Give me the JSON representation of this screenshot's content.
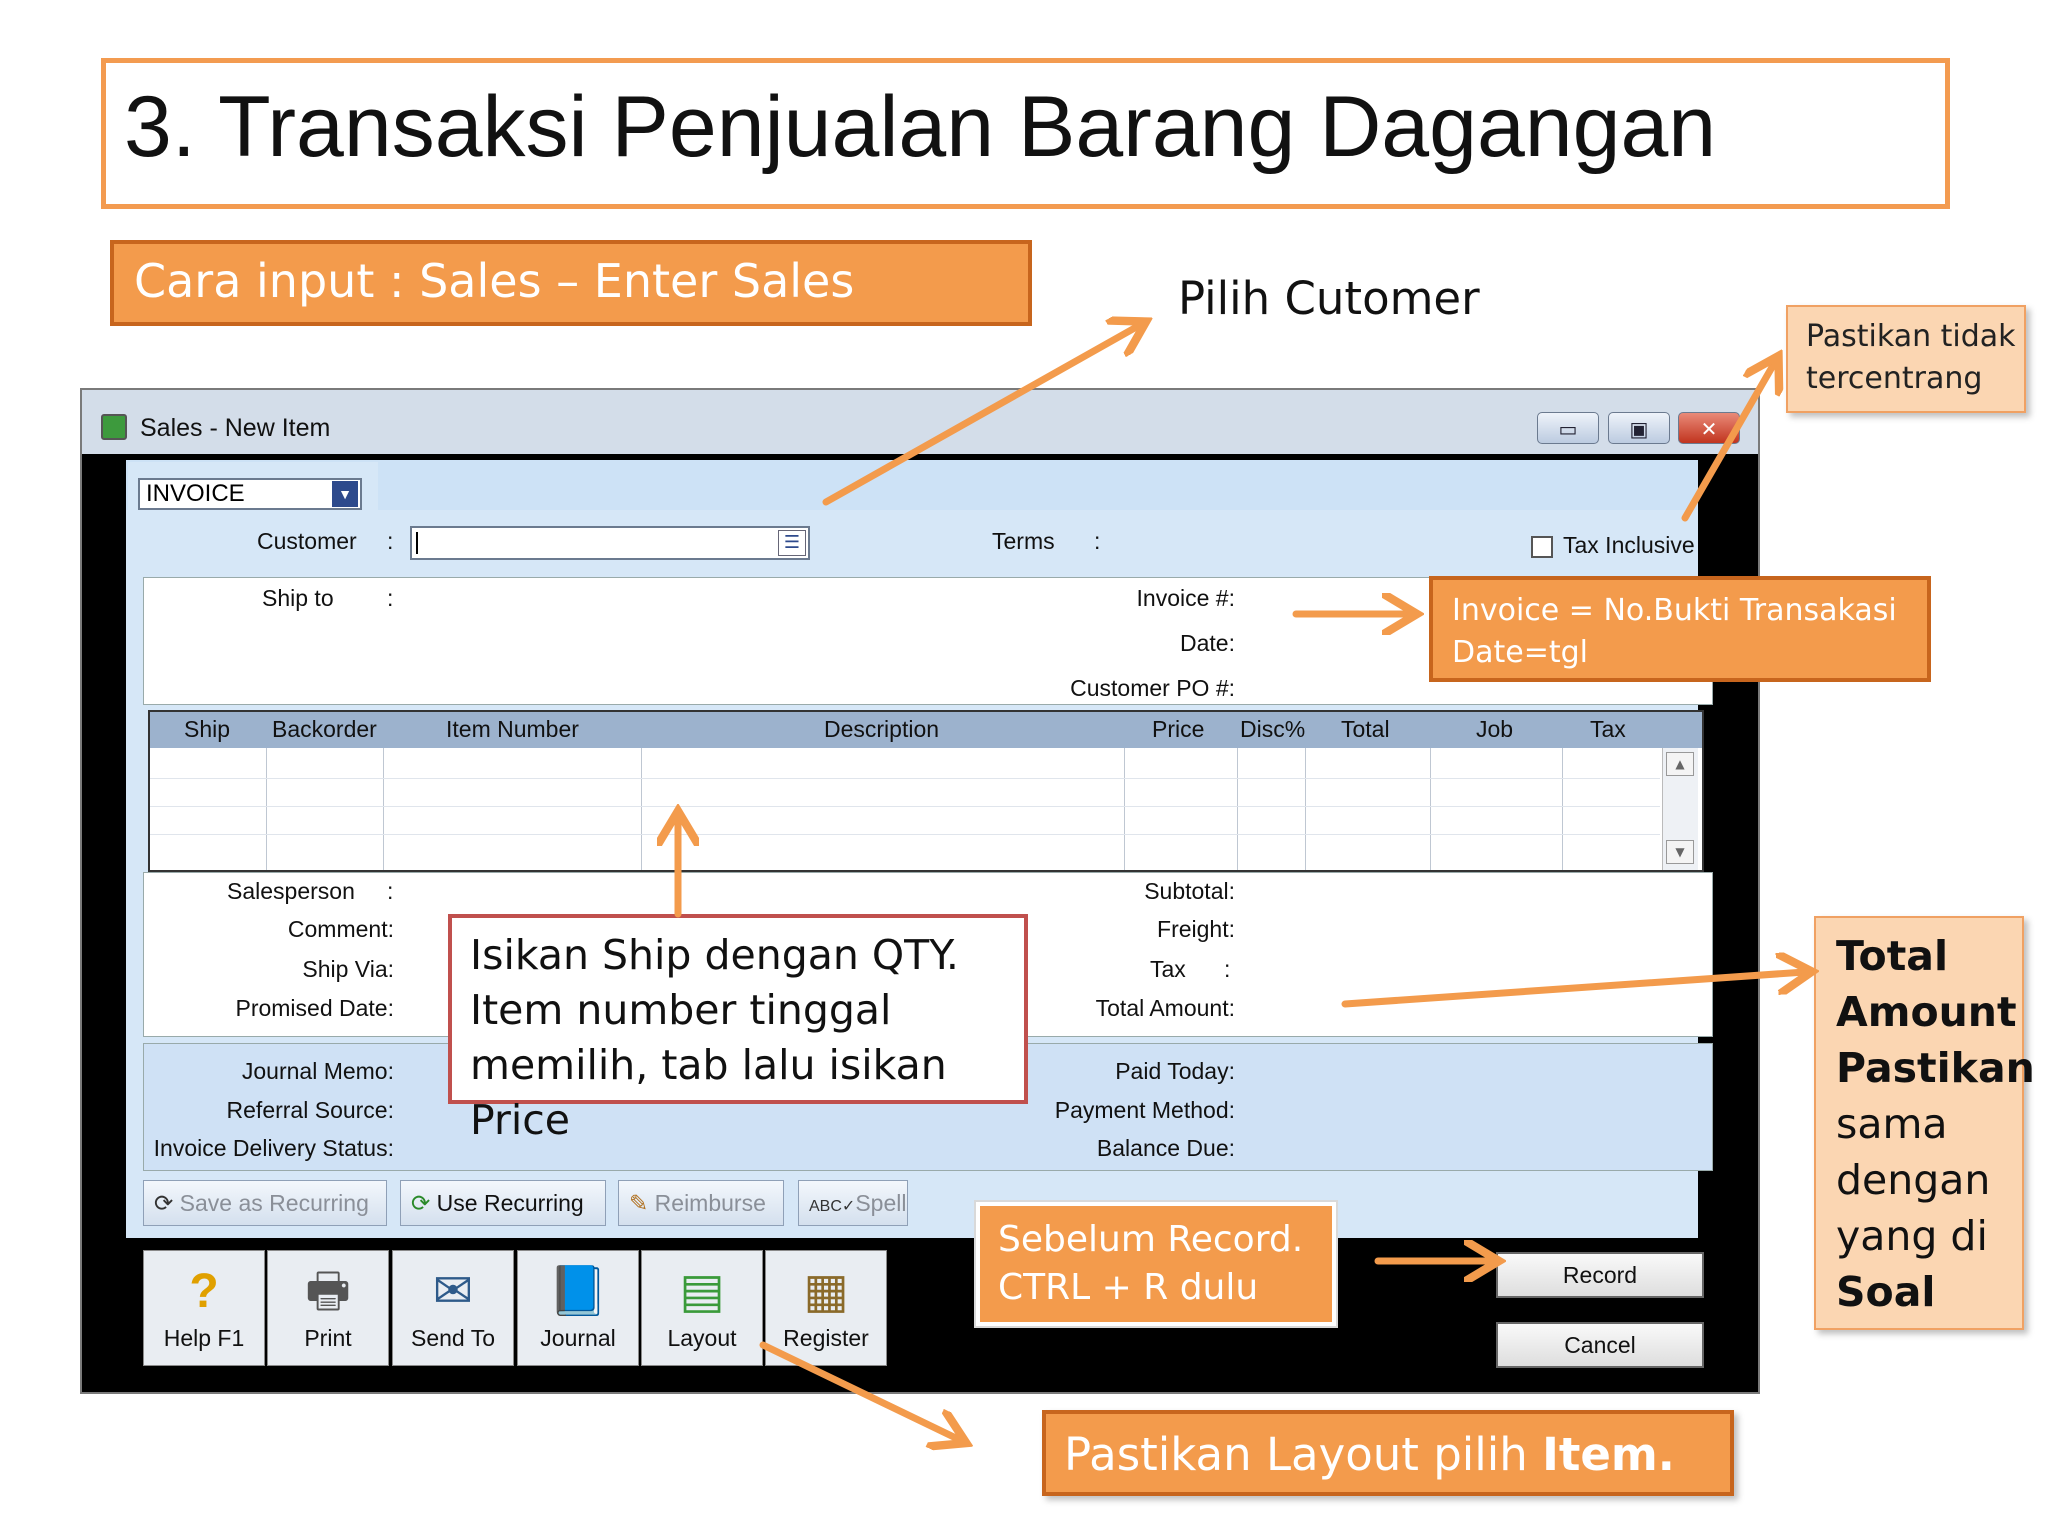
{
  "slide": {
    "number": "3.",
    "title": "Transaksi Penjualan Barang Dagangan",
    "subtitle": "Cara input : Sales – Enter Sales"
  },
  "notes": {
    "pilih_customer": "Pilih Cutomer",
    "tax_inclusive": "Pastikan tidak tercentrang",
    "invoice": "Invoice = No.Bukti Transakasi Date=tgl",
    "invoice_line1": "Invoice = No.Bukti Transakasi",
    "invoice_line2": "Date=tgl",
    "total_amount_bold1": "Total Amount Pastikan",
    "total_amount_rest": "sama dengan yang di",
    "total_amount_bold2": "Soal",
    "ship_qty": "Isikan Ship dengan QTY. Item number tinggal memilih, tab lalu isikan Price",
    "record": "Sebelum Record. CTRL + R dulu",
    "record_line1": "Sebelum Record.",
    "record_line2": "CTRL + R dulu",
    "layout_prefix": "Pastikan Layout pilih ",
    "layout_bold": "Item."
  },
  "window": {
    "title": "Sales - New Item",
    "invoice_type": "INVOICE",
    "fields": {
      "customer": "Customer",
      "terms": "Terms",
      "tax_inclusive": "Tax Inclusive",
      "ship_to": "Ship to",
      "invoice_no": "Invoice #:",
      "date": "Date:",
      "customer_po": "Customer PO #:",
      "salesperson": "Salesperson",
      "comment": "Comment:",
      "ship_via": "Ship Via:",
      "promised_date": "Promised Date:",
      "subtotal": "Subtotal:",
      "freight": "Freight:",
      "tax": "Tax",
      "total_amount": "Total Amount:",
      "journal_memo": "Journal Memo:",
      "referral_source": "Referral Source:",
      "invoice_delivery_status": "Invoice Delivery Status:",
      "paid_today": "Paid Today:",
      "payment_method": "Payment Method:",
      "balance_due": "Balance Due:"
    },
    "colon": ":",
    "columns": [
      "Ship",
      "Backorder",
      "Item Number",
      "Description",
      "Price",
      "Disc%",
      "Total",
      "Job",
      "Tax"
    ],
    "toolbar": {
      "save_recurring": "Save as Recurring",
      "use_recurring": "Use Recurring",
      "reimburse": "Reimburse",
      "spell": "Spell"
    },
    "buttons": {
      "help": "Help F1",
      "print": "Print",
      "send_to": "Send To",
      "journal": "Journal",
      "layout": "Layout",
      "register": "Register",
      "record": "Record",
      "cancel": "Cancel"
    }
  }
}
